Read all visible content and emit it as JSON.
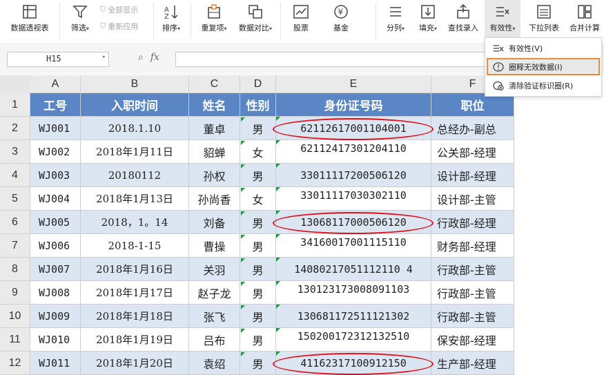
{
  "ribbon": {
    "pivot": "数据透视表",
    "filter": "筛选",
    "show_all": "全部显示",
    "reapply": "重新应用",
    "sort": "排序",
    "duplicates": "重复项",
    "compare": "数据对比",
    "stock": "股票",
    "fund": "基金",
    "split": "分列",
    "fill": "填充",
    "lookup": "查找录入",
    "validity": "有效性",
    "dropdown_list": "下拉列表",
    "merge_calc": "合并计算"
  },
  "formula_bar": {
    "name_box": "H15",
    "fx": "fx",
    "formula": ""
  },
  "columns": [
    "A",
    "B",
    "C",
    "D",
    "E",
    "F"
  ],
  "rows": [
    "1",
    "2",
    "3",
    "4",
    "5",
    "6",
    "7",
    "8",
    "9",
    "10",
    "11",
    "12"
  ],
  "table": {
    "headers": [
      "工号",
      "入职时间",
      "姓名",
      "性别",
      "身份证号码",
      "职位"
    ],
    "records": [
      [
        "WJ001",
        "2018.1.10",
        "董卓",
        "男",
        "62112617001104001",
        "总经办-副总"
      ],
      [
        "WJ002",
        "2018年1月11日",
        "貂蝉",
        "女",
        "62112417301204110",
        "公关部-经理"
      ],
      [
        "WJ003",
        "20180112",
        "孙权",
        "男",
        "33011117200506120",
        "设计部-经理"
      ],
      [
        "WJ004",
        "2018年1月13日",
        "孙尚香",
        "女",
        "33011117030302110",
        "设计部-主管"
      ],
      [
        "WJ005",
        "2018，1。14",
        "刘备",
        "男",
        "13068117000506120",
        "行政部-经理"
      ],
      [
        "WJ006",
        "2018-1-15",
        "曹操",
        "男",
        "34160017001115110",
        "财务部-经理"
      ],
      [
        "WJ007",
        "2018年1月16日",
        "关羽",
        "男",
        "14080217051112110 4",
        "行政部-主管"
      ],
      [
        "WJ008",
        "2018年1月17日",
        "赵子龙",
        "男",
        "130123173008091103",
        "行政部-主管"
      ],
      [
        "WJ009",
        "2018年1月18日",
        "张飞",
        "男",
        "130681172511121302",
        "行政部-主管"
      ],
      [
        "WJ010",
        "2018年1月19日",
        "吕布",
        "男",
        "150200172312132510",
        "保安部-经理"
      ],
      [
        "WJ011",
        "2018年1月20日",
        "袁绍",
        "男",
        "41162317100912150",
        "生产部-经理"
      ]
    ]
  },
  "validity_menu": {
    "items": [
      {
        "label": "有效性(V)",
        "icon": "validation-icon",
        "selected": false
      },
      {
        "label": "圈释无效数据(I)",
        "icon": "circle-invalid-icon",
        "selected": true
      },
      {
        "label": "清除验证标识圈(R)",
        "icon": "clear-circles-icon",
        "selected": false
      }
    ]
  },
  "invalid_rows": [
    1,
    5,
    11
  ],
  "colors": {
    "header_fill": "#5b86c5",
    "band_fill": "#dce6f2",
    "circle": "#e3101a",
    "menu_highlight": "#f0893b"
  }
}
